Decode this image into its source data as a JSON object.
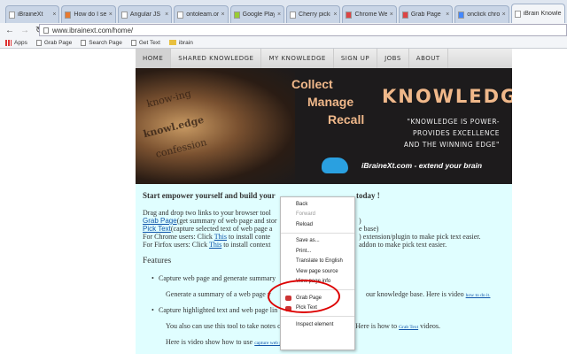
{
  "browser": {
    "tabs": [
      "iBraineXt",
      "How do I setu",
      "Angular JS in",
      "ontoleam.org",
      "Google Play fo",
      "Cherry picking",
      "Chrome Web",
      "Grab Page - E",
      "onclick chrom",
      "iBrain Knowle"
    ],
    "url": "www.ibrainext.com/home/",
    "bookmarks": [
      "Apps",
      "Grab Page",
      "Search Page",
      "Get Text",
      "ibrain"
    ]
  },
  "nav": [
    "HOME",
    "SHARED KNOWLEDGE",
    "MY KNOWLEDGE",
    "SIGN UP",
    "JOBS",
    "ABOUT"
  ],
  "banner": {
    "collect": "Collect",
    "manage": "Manage",
    "recall": "Recall",
    "knowledge": "KNOWLEDGE",
    "quote": [
      "\"KNOWLEDGE IS POWER-",
      "PROVIDES EXCELLENCE",
      "AND THE WINNING EDGE\""
    ],
    "tagline": "iBraineXt.com - extend your brain",
    "book_words": [
      "know-ing",
      "knowl.edge",
      "confession"
    ]
  },
  "content": {
    "heading_a": "Start empower yourself and build your",
    "heading_b": "today !",
    "l1": "Drag and drop two links to your browser tool",
    "l2_link": "Grab Page",
    "l2": "(get summary of web page and stor",
    "l2_r": ")",
    "l3_link": "Pick Text",
    "l3": "(capture selected text of web page a",
    "l3_r": "e base)",
    "l4": "For Chrome users: Click ",
    "l4_link": "This",
    "l4_b": " to install conte",
    "l4_r": ") extension/plugin to make pick text easier.",
    "l5": "For Firfox users: Click ",
    "l5_link": "This",
    "l5_b": " to install context",
    "l5_r": "addon to make pick text easier.",
    "features": "Features",
    "f1": "Capture web page and generate summary",
    "f1_sub": "Generate a summary of a web page y",
    "f1_sub_r": "our knowledge base. Here is video ",
    "f1_link": "how to do it.",
    "f2": "Capture highlighted text and web page lin",
    "f2_sub": "You also can use this tool to take notes or memo from a web page. Here is how to ",
    "f2_link": "Grab Text",
    "f2_end": " videos.",
    "f3": "Here is video show how to use ",
    "f3_link": "capture web page and generate summary"
  },
  "context_menu": [
    "Back",
    "Forward",
    "Reload",
    "Save as...",
    "Print...",
    "Translate to English",
    "View page source",
    "View page info",
    "Grab Page",
    "Pick Text",
    "Inspect element"
  ]
}
